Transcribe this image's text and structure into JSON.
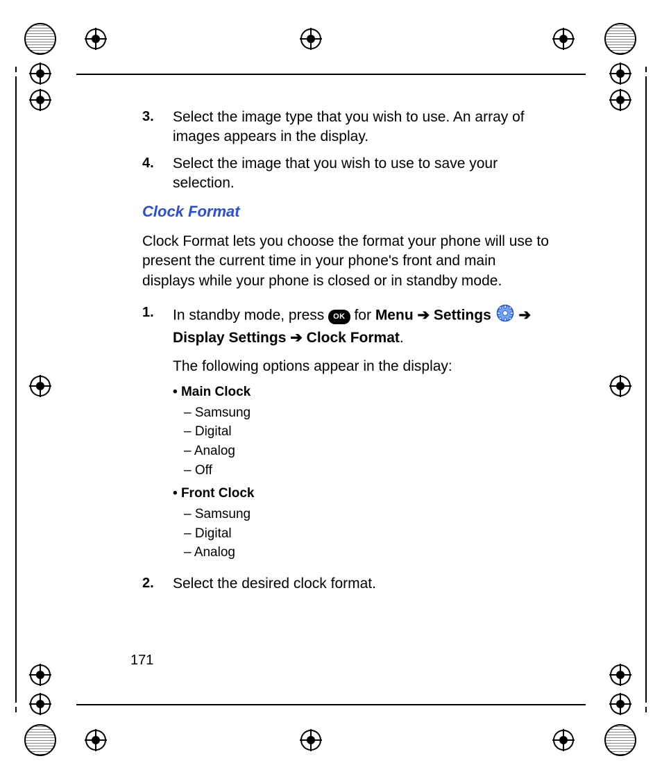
{
  "steps_top": [
    {
      "num": "3.",
      "text": "Select the image type that you wish to use. An array of images appears in the display."
    },
    {
      "num": "4.",
      "text": "Select the image that you wish to use to save your selection."
    }
  ],
  "section_heading": "Clock Format",
  "intro": "Clock Format lets you choose the format your phone will use to present the current time in your phone's front and main displays while your phone is closed or in standby mode.",
  "step1": {
    "num": "1.",
    "prefix": "In standby mode, press ",
    "ok_label": "OK",
    "mid1": " for ",
    "menu": "Menu",
    "arrow": " ➔ ",
    "settings": "Settings",
    "post_icon": " ➔ ",
    "disp": "Display Settings",
    "arrow2": " ➔ ",
    "clockfmt": "Clock Format",
    "period": ".",
    "follow": "The following options appear in the display:"
  },
  "options": [
    {
      "title": "Main Clock",
      "items": [
        "Samsung",
        "Digital",
        "Analog",
        "Off"
      ]
    },
    {
      "title": "Front Clock",
      "items": [
        "Samsung",
        "Digital",
        "Analog"
      ]
    }
  ],
  "step2": {
    "num": "2.",
    "text": "Select the desired clock format."
  },
  "page_number": "171"
}
